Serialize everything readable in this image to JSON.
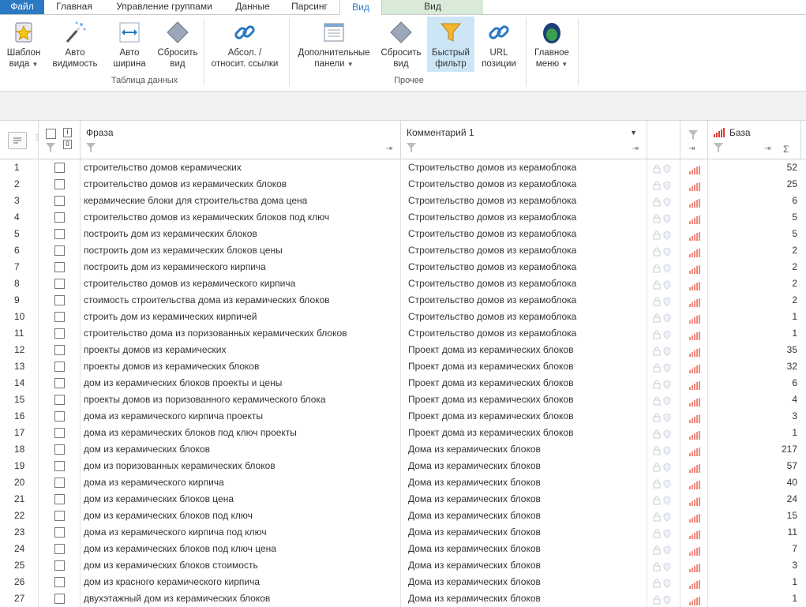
{
  "menu": {
    "tabs": [
      "Файл",
      "Главная",
      "Управление группами",
      "Данные",
      "Парсинг",
      "Вид"
    ],
    "context_tab": "Вид"
  },
  "ribbon": {
    "buttons": [
      {
        "line1": "Шаблон",
        "line2": "вида"
      },
      {
        "line1": "Авто",
        "line2": "видимость"
      },
      {
        "line1": "Авто",
        "line2": "ширина"
      },
      {
        "line1": "Сбросить",
        "line2": "вид"
      },
      {
        "line1": "Абсол. /",
        "line2": "относит. ссылки"
      },
      {
        "line1": "Дополнительные",
        "line2": "панели"
      },
      {
        "line1": "Сбросить",
        "line2": "вид"
      },
      {
        "line1": "Быстрый",
        "line2": "фильтр"
      },
      {
        "line1": "URL",
        "line2": "позиции"
      },
      {
        "line1": "Главное",
        "line2": "меню"
      }
    ],
    "groups": [
      "Таблица данных",
      "Прочее"
    ]
  },
  "grid": {
    "headers": {
      "phrase": "Фраза",
      "comment": "Комментарий 1",
      "base": "База"
    },
    "colors": {
      "bars": "#e03c31",
      "accent": "#2b79c2"
    },
    "rows": [
      {
        "n": "1",
        "phrase": "строительство домов керамических",
        "comment": "Строительство домов из керамоблока",
        "base": "52"
      },
      {
        "n": "2",
        "phrase": "строительство домов из керамических блоков",
        "comment": "Строительство домов из керамоблока",
        "base": "25"
      },
      {
        "n": "3",
        "phrase": "керамические блоки для строительства дома цена",
        "comment": "Строительство домов из керамоблока",
        "base": "6"
      },
      {
        "n": "4",
        "phrase": "строительство домов из керамических блоков под ключ",
        "comment": "Строительство домов из керамоблока",
        "base": "5"
      },
      {
        "n": "5",
        "phrase": "построить дом из керамических блоков",
        "comment": "Строительство домов из керамоблока",
        "base": "5"
      },
      {
        "n": "6",
        "phrase": "построить дом из керамических блоков цены",
        "comment": "Строительство домов из керамоблока",
        "base": "2"
      },
      {
        "n": "7",
        "phrase": "построить дом из керамического кирпича",
        "comment": "Строительство домов из керамоблока",
        "base": "2"
      },
      {
        "n": "8",
        "phrase": "строительство домов из керамического кирпича",
        "comment": "Строительство домов из керамоблока",
        "base": "2"
      },
      {
        "n": "9",
        "phrase": "стоимость строительства дома из керамических блоков",
        "comment": "Строительство домов из керамоблока",
        "base": "2"
      },
      {
        "n": "10",
        "phrase": "строить дом из керамических кирпичей",
        "comment": "Строительство домов из керамоблока",
        "base": "1"
      },
      {
        "n": "11",
        "phrase": "строительство дома из поризованных керамических блоков",
        "comment": "Строительство домов из керамоблока",
        "base": "1"
      },
      {
        "n": "12",
        "phrase": "проекты домов из керамических",
        "comment": "Проект дома из керамических блоков",
        "base": "35"
      },
      {
        "n": "13",
        "phrase": "проекты домов из керамических блоков",
        "comment": "Проект дома из керамических блоков",
        "base": "32"
      },
      {
        "n": "14",
        "phrase": "дом из керамических блоков проекты и цены",
        "comment": "Проект дома из керамических блоков",
        "base": "6"
      },
      {
        "n": "15",
        "phrase": "проекты домов из поризованного керамического блока",
        "comment": "Проект дома из керамических блоков",
        "base": "4"
      },
      {
        "n": "16",
        "phrase": "дома из керамического кирпича проекты",
        "comment": "Проект дома из керамических блоков",
        "base": "3"
      },
      {
        "n": "17",
        "phrase": "дома из керамических блоков под ключ проекты",
        "comment": "Проект дома из керамических блоков",
        "base": "1"
      },
      {
        "n": "18",
        "phrase": "дом из керамических блоков",
        "comment": "Дома из керамических блоков",
        "base": "217"
      },
      {
        "n": "19",
        "phrase": "дом из поризованных керамических блоков",
        "comment": "Дома из керамических блоков",
        "base": "57"
      },
      {
        "n": "20",
        "phrase": "дома из керамического кирпича",
        "comment": "Дома из керамических блоков",
        "base": "40"
      },
      {
        "n": "21",
        "phrase": "дом из керамических блоков цена",
        "comment": "Дома из керамических блоков",
        "base": "24"
      },
      {
        "n": "22",
        "phrase": "дом из керамических блоков под ключ",
        "comment": "Дома из керамических блоков",
        "base": "15"
      },
      {
        "n": "23",
        "phrase": "дома из керамического кирпича под ключ",
        "comment": "Дома из керамических блоков",
        "base": "11"
      },
      {
        "n": "24",
        "phrase": "дом из керамических блоков под ключ цена",
        "comment": "Дома из керамических блоков",
        "base": "7"
      },
      {
        "n": "25",
        "phrase": "дом из керамических блоков стоимость",
        "comment": "Дома из керамических блоков",
        "base": "3"
      },
      {
        "n": "26",
        "phrase": "дом из красного керамического кирпича",
        "comment": "Дома из керамических блоков",
        "base": "1"
      },
      {
        "n": "27",
        "phrase": "двухэтажный дом из керамических блоков",
        "comment": "Дома из керамических блоков",
        "base": "1"
      }
    ]
  }
}
